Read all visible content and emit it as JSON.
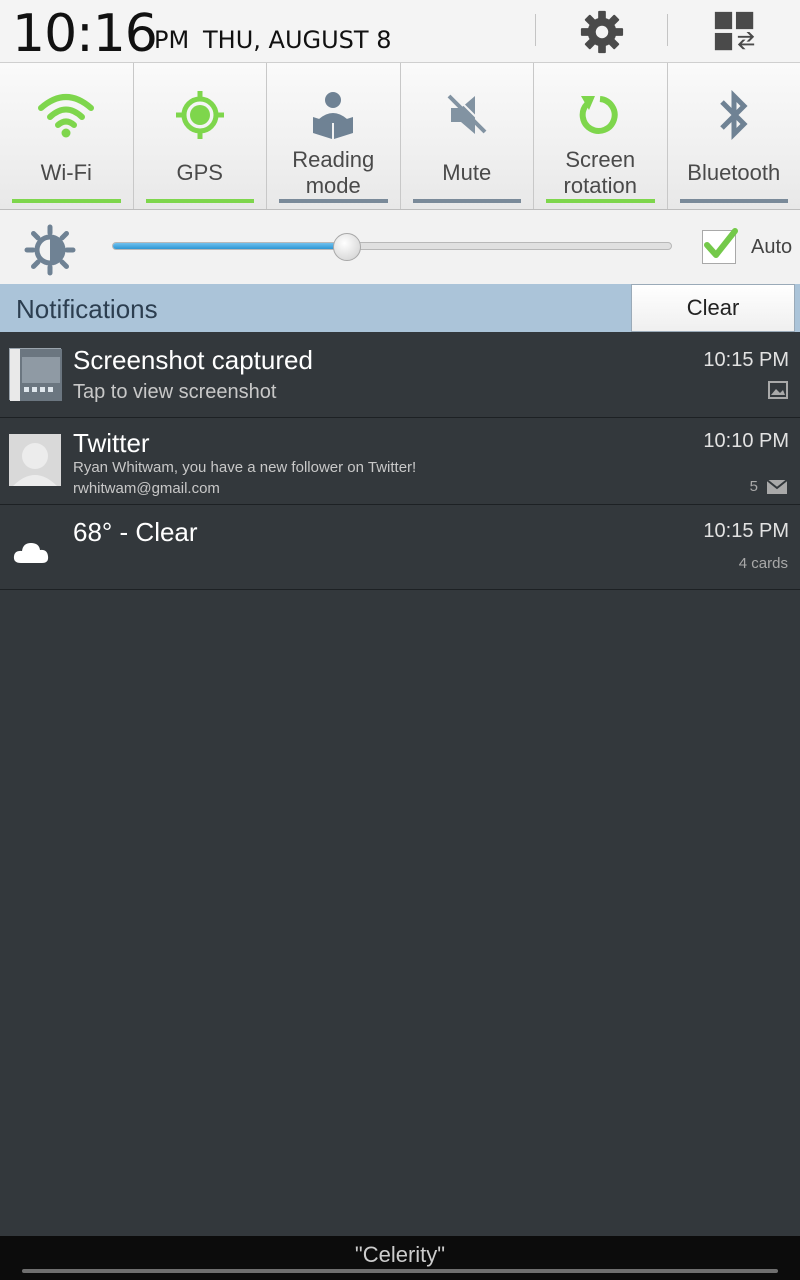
{
  "status": {
    "time": "10:16",
    "ampm": "PM",
    "date": "THU, AUGUST 8",
    "icons": [
      "gear-icon",
      "multi-window-icon"
    ]
  },
  "toggles": [
    {
      "label": "Wi-Fi",
      "icon": "wifi-icon",
      "active": true
    },
    {
      "label": "GPS",
      "icon": "gps-icon",
      "active": true
    },
    {
      "label": "Reading\nmode",
      "icon": "reading-mode-icon",
      "active": false
    },
    {
      "label": "Mute",
      "icon": "mute-icon",
      "active": false
    },
    {
      "label": "Screen\nrotation",
      "icon": "screen-rotation-icon",
      "active": true
    },
    {
      "label": "Bluetooth",
      "icon": "bluetooth-icon",
      "active": false
    }
  ],
  "brightness": {
    "level_fraction": 0.42,
    "auto_label": "Auto",
    "auto_checked": true,
    "icon": "brightness-icon"
  },
  "notifications": {
    "header": "Notifications",
    "clear_label": "Clear",
    "items": [
      {
        "title": "Screenshot captured",
        "subtitle": "Tap to view screenshot",
        "time": "10:15 PM",
        "icon": "screenshot-thumbnail",
        "meta_icon": "image-icon"
      },
      {
        "title": "Twitter",
        "subtitle": "Ryan Whitwam, you have a new follower on Twitter!",
        "account": "rwhitwam@gmail.com",
        "time": "10:10 PM",
        "icon": "avatar-icon",
        "count": "5",
        "meta_icon": "email-icon"
      },
      {
        "title": "68° - Clear",
        "time": "10:15 PM",
        "icon": "cloud-icon",
        "meta": "4 cards"
      }
    ]
  },
  "carrier": "\"Celerity\"",
  "colors": {
    "toggle_active": "#7ed64c",
    "toggle_inactive": "#7a8a99",
    "notif_header_bg": "#abc4d9",
    "panel_bg": "#33383c"
  }
}
